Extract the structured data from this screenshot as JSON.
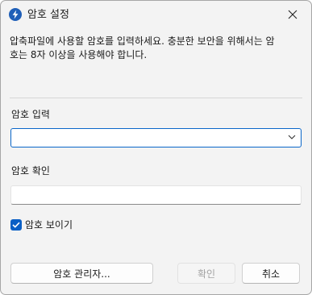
{
  "window": {
    "title": "암호 설정",
    "icon": "bandizip-lightning-icon",
    "close_icon": "close-icon"
  },
  "description": "압축파일에 사용할 암호를 입력하세요. 충분한 보안을 위해서는 암\n호는 8자 이상을 사용해야 합니다.",
  "password_input": {
    "label": "암호 입력",
    "value": "",
    "dropdown_icon": "chevron-down-icon"
  },
  "password_confirm": {
    "label": "암호 확인",
    "value": ""
  },
  "show_password": {
    "label": "암호 보이기",
    "checked": true
  },
  "buttons": {
    "manager": "암호 관리자...",
    "ok": "확인",
    "cancel": "취소"
  },
  "colors": {
    "accent": "#0a5fc5",
    "dialog_bg": "#f3f3f3",
    "icon_bg": "#1f5fb8"
  }
}
